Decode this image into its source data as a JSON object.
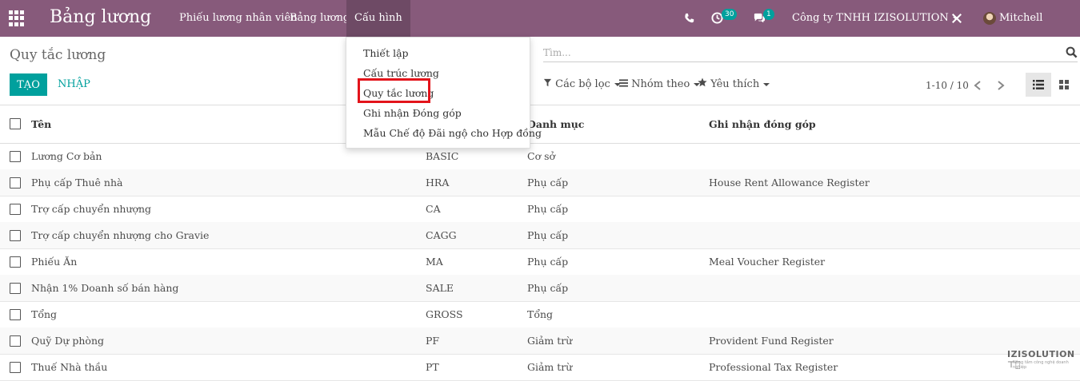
{
  "app": {
    "title": "Bảng lương"
  },
  "nav": {
    "items": [
      {
        "label": "Phiếu lương nhân viên"
      },
      {
        "label": "Bảng lương"
      },
      {
        "label": "Cấu hình"
      }
    ]
  },
  "systray": {
    "activity_count": "30",
    "message_count": "1",
    "company": "Công ty TNHH IZISOLUTION",
    "user": "Mitchell Admin"
  },
  "control_panel": {
    "breadcrumb": "Quy tắc lương",
    "create_label": "TẠO",
    "import_label": "NHẬP",
    "search_placeholder": "Tìm...",
    "filters_label": "Các bộ lọc",
    "groupby_label": "Nhóm theo",
    "favorites_label": "Yêu thích",
    "pager": "1-10 / 10"
  },
  "dropdown": {
    "items": [
      {
        "label": "Thiết lập"
      },
      {
        "label": "Cấu trúc lương"
      },
      {
        "label": "Quy tắc lương"
      },
      {
        "label": "Ghi nhận Đóng góp"
      },
      {
        "label": "Mẫu Chế độ Đãi ngộ cho Hợp đồng"
      }
    ],
    "highlighted_index": 2
  },
  "table": {
    "columns": [
      "Tên",
      "Danh mục",
      "Ghi nhận đóng góp"
    ],
    "rows": [
      {
        "name": "Lương Cơ bản",
        "code": "BASIC",
        "category": "Cơ sở",
        "register": ""
      },
      {
        "name": "Phụ cấp Thuê nhà",
        "code": "HRA",
        "category": "Phụ cấp",
        "register": "House Rent Allowance Register"
      },
      {
        "name": "Trợ cấp chuyển nhượng",
        "code": "CA",
        "category": "Phụ cấp",
        "register": ""
      },
      {
        "name": "Trợ cấp chuyển nhượng cho Gravie",
        "code": "CAGG",
        "category": "Phụ cấp",
        "register": ""
      },
      {
        "name": "Phiếu Ăn",
        "code": "MA",
        "category": "Phụ cấp",
        "register": "Meal Voucher Register"
      },
      {
        "name": "Nhận 1% Doanh số bán hàng",
        "code": "SALE",
        "category": "Phụ cấp",
        "register": ""
      },
      {
        "name": "Tổng",
        "code": "GROSS",
        "category": "Tổng",
        "register": ""
      },
      {
        "name": "Quỹ Dự phòng",
        "code": "PF",
        "category": "Giảm trừ",
        "register": "Provident Fund Register"
      },
      {
        "name": "Thuế Nhà thầu",
        "code": "PT",
        "category": "Giảm trừ",
        "register": "Professional Tax Register"
      }
    ]
  },
  "watermark": {
    "text": "IZISOLUTION",
    "tagline": "Nâng tầm công nghệ doanh nghiệp"
  },
  "colors": {
    "topbar": "#875a7b",
    "accent": "#00a09d",
    "highlight_border": "#e3141b"
  }
}
